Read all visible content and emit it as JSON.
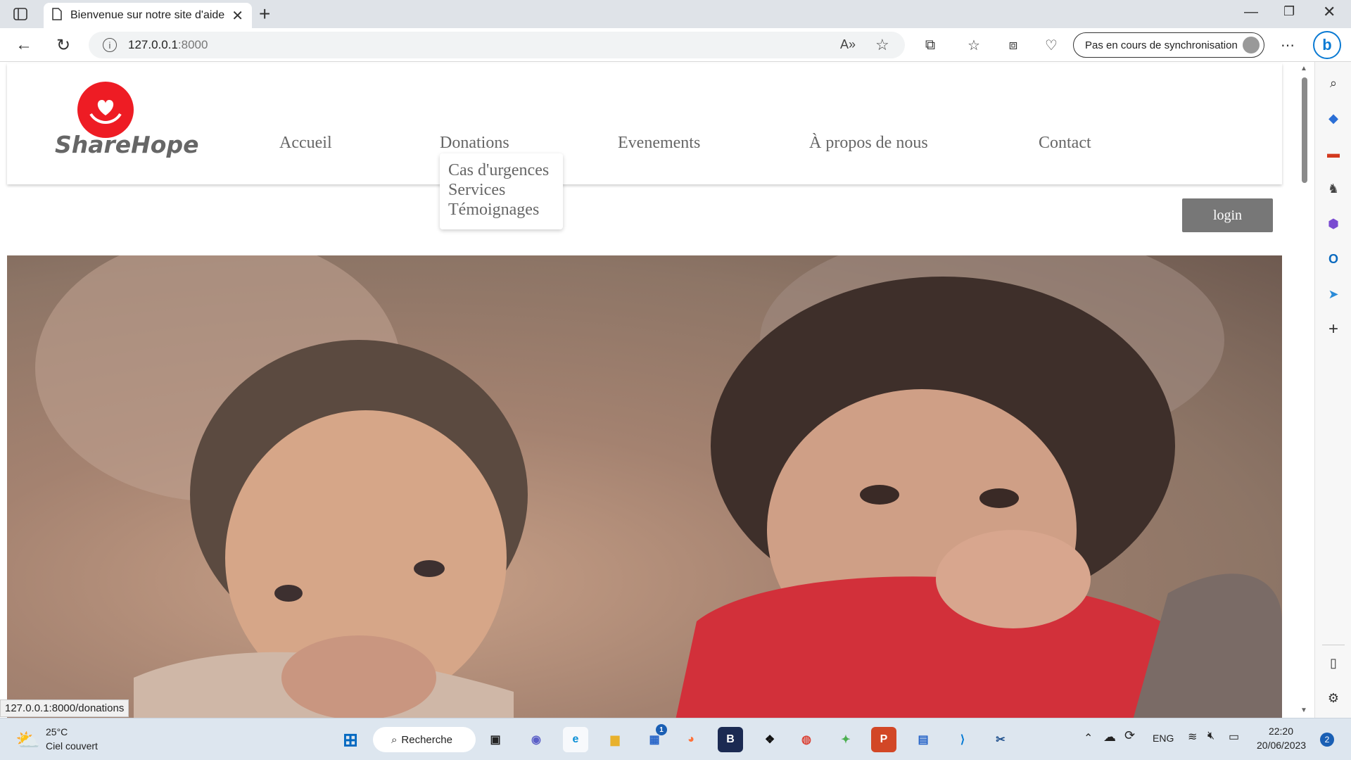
{
  "browser": {
    "tab_title": "Bienvenue sur notre site d'aide e",
    "url_host": "127.0.0.1",
    "url_port": ":8000",
    "sync_label": "Pas en cours de synchronisation",
    "status_url": "127.0.0.1:8000/donations"
  },
  "site": {
    "logo_text": "ShareHope",
    "menu": {
      "home": "Accueil",
      "donations": "Donations",
      "events": "Evenements",
      "about": "À propos de nous",
      "contact": "Contact"
    },
    "dropdown": [
      "Cas d'urgences",
      "Services",
      "Témoignages"
    ],
    "login_label": "login"
  },
  "taskbar": {
    "temperature": "25°C",
    "weather": "Ciel couvert",
    "search_label": "Recherche",
    "language": "ENG",
    "time": "22:20",
    "date": "20/06/2023",
    "notification_count": "2",
    "store_badge": "1"
  },
  "colors": {
    "logo_red": "#ee1c24",
    "login_bg": "#777777",
    "taskbar_bg": "#dde6ef",
    "accent_blue": "#0067c0"
  }
}
